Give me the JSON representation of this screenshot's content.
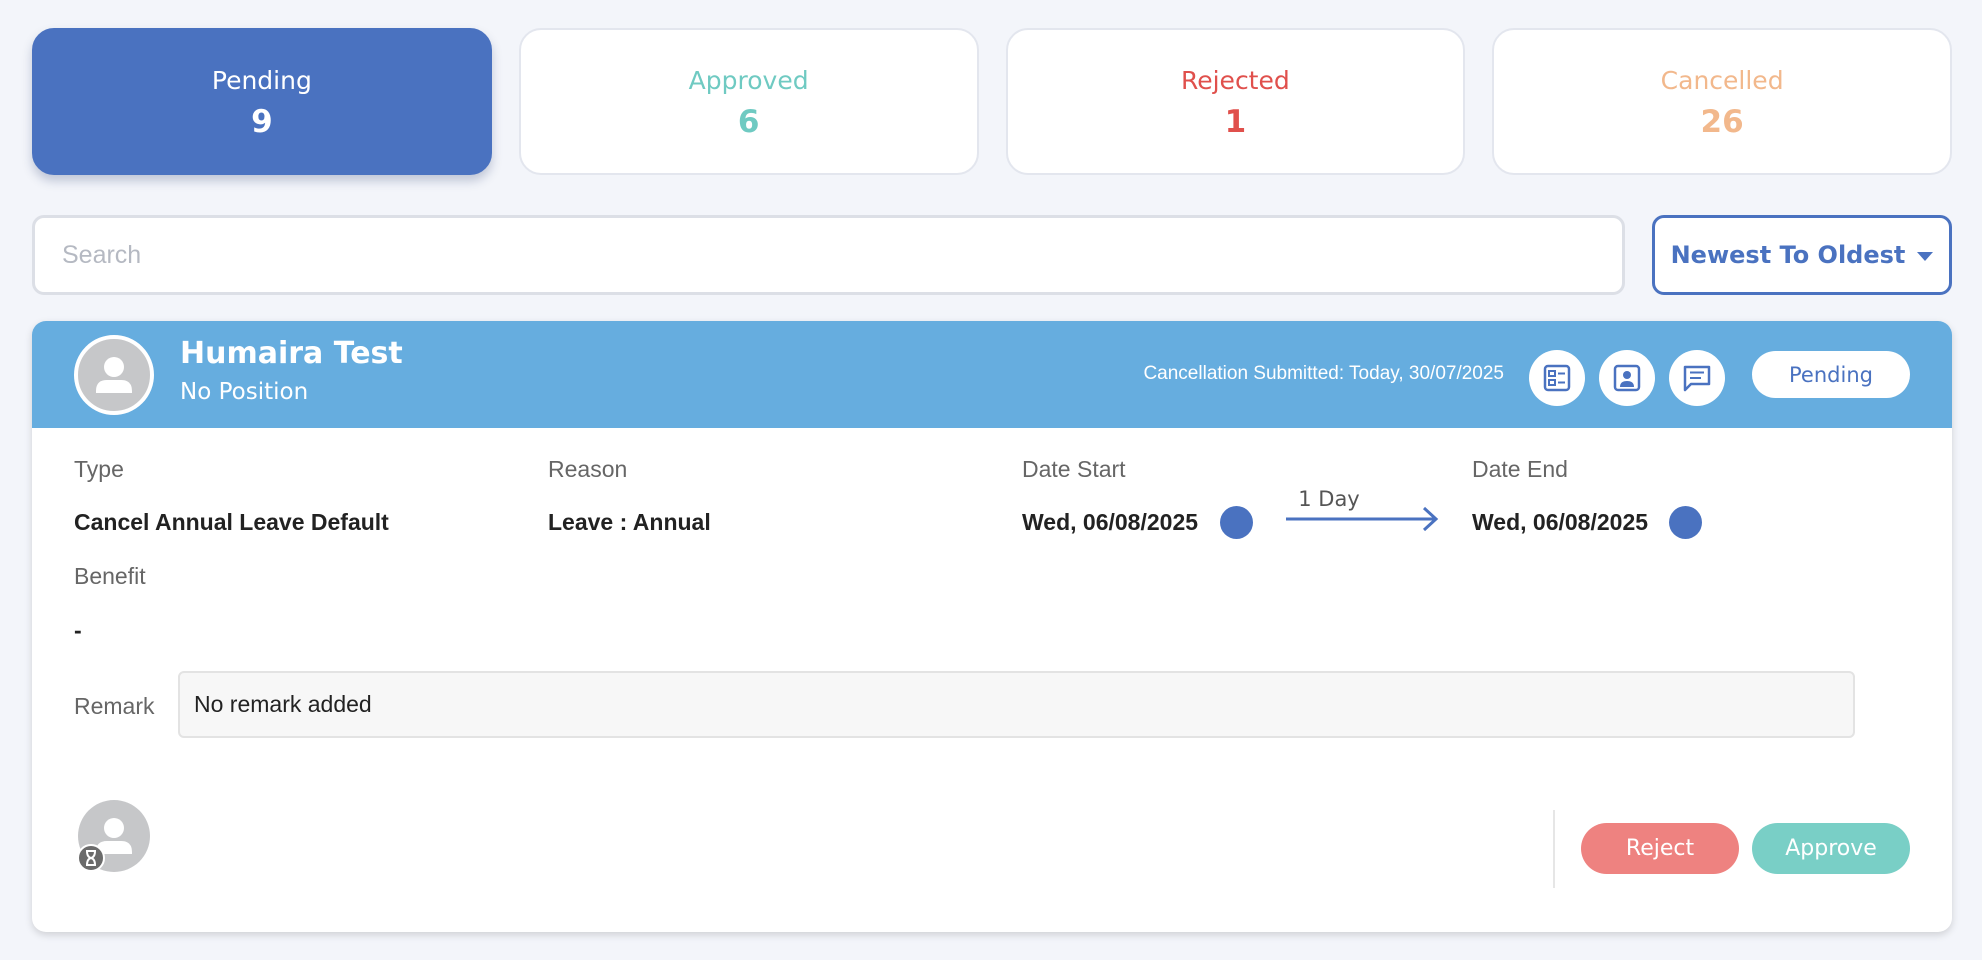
{
  "tabs": [
    {
      "label": "Pending",
      "count": "9",
      "color": "#ffffff",
      "active": true
    },
    {
      "label": "Approved",
      "count": "6",
      "color": "#6fcac2",
      "active": false
    },
    {
      "label": "Rejected",
      "count": "1",
      "color": "#e0504c",
      "active": false
    },
    {
      "label": "Cancelled",
      "count": "26",
      "color": "#f2b88c",
      "active": false
    }
  ],
  "search": {
    "placeholder": "Search",
    "value": ""
  },
  "sort": {
    "label": "Newest To Oldest",
    "icon": "caret-down-icon"
  },
  "request": {
    "employee_name": "Humaira Test",
    "position": "No Position",
    "submitted": "Cancellation Submitted: Today, 30/07/2025",
    "header_icons": [
      "details-icon",
      "profile-icon",
      "comment-icon"
    ],
    "status": "Pending",
    "type_label": "Type",
    "type_value": "Cancel Annual Leave Default",
    "reason_label": "Reason",
    "reason_value": "Leave : Annual",
    "date_start_label": "Date Start",
    "date_start_value": "Wed, 06/08/2025",
    "duration": "1 Day",
    "date_end_label": "Date End",
    "date_end_value": "Wed, 06/08/2025",
    "benefit_label": "Benefit",
    "benefit_value": "-",
    "remark_label": "Remark",
    "remark_value": "No remark added",
    "reject_label": "Reject",
    "approve_label": "Approve"
  },
  "colors": {
    "primary": "#4a72c0",
    "header": "#66addf",
    "reject": "#ee8280",
    "approve": "#79cfc6"
  }
}
